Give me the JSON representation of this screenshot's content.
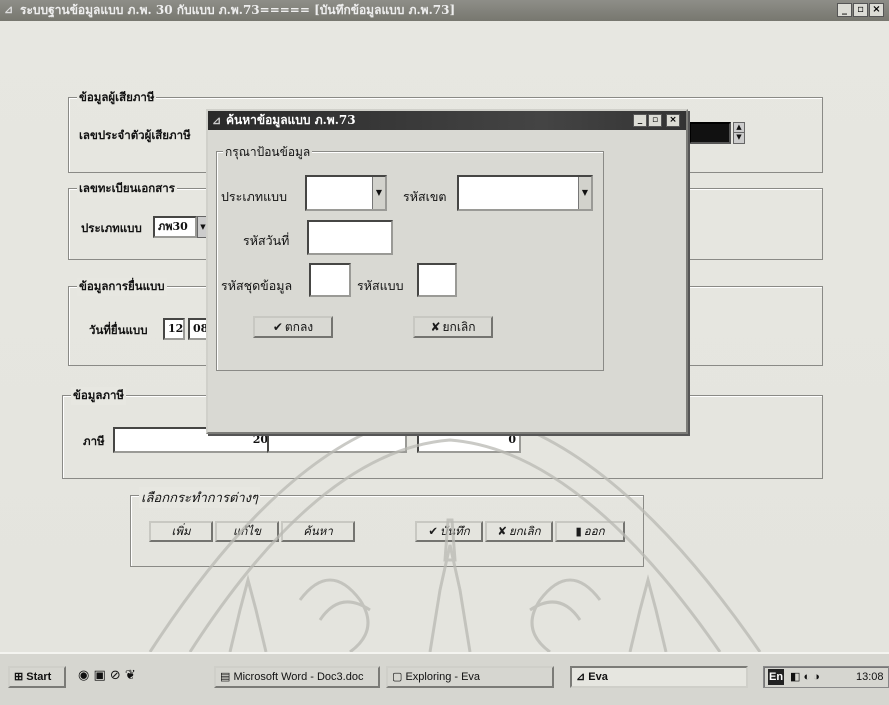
{
  "window": {
    "title": "ระบบฐานข้อมูลแบบ ภ.พ. 30 กับแบบ ภ.พ.73===== [บันทึกข้อมูลแบบ ภ.พ.73]",
    "min_glyph": "_",
    "max_glyph": "▫",
    "close_glyph": "×"
  },
  "taxpayer": {
    "group_label": "ข้อมูลผู้เสียภาษี",
    "tax_id_label": "เลขประจำตัวผู้เสียภาษี"
  },
  "control": {
    "group_label": "เลขทะเบียนเอกสาร",
    "form_type_label": "ประเภทแบบ",
    "form_type_value": "ภพ30"
  },
  "filing": {
    "group_label": "ข้อมูลการยื่นแบบ",
    "date_label": "วันที่ยื่นแบบ",
    "day_value": "12",
    "month_value": "08"
  },
  "tax": {
    "group_label": "ข้อมูลภาษี",
    "tax_label": "ภาษี",
    "tax_value": "20",
    "field2_value": "",
    "field3_value": "0"
  },
  "actions": {
    "group_label": "เลือกกระทำการต่างๆ",
    "add": "เพิ่ม",
    "edit": "แก้ไข",
    "search": "ค้นหา",
    "save": "บันทึก",
    "cancel": "ยกเลิก",
    "exit": "ออก"
  },
  "dialog": {
    "title": "ค้นหาข้อมูลแบบ ภ.พ.73",
    "group_label": "กรุณาป้อนข้อมูล",
    "form_type_label": "ประเภทแบบ",
    "zone_label": "รหัสเขต",
    "date_code_label": "รหัสวันที่",
    "dataset_label": "รหัสชุดข้อมูล",
    "form_code_label": "รหัสแบบ",
    "ok": "ตกลง",
    "cancel": "ยกเลิก"
  },
  "taskbar": {
    "start": "Start",
    "word": "Microsoft Word - Doc3.doc",
    "explorer": "Exploring - Eva",
    "eva": "Eva",
    "lang": "En",
    "clock": "13:08"
  }
}
